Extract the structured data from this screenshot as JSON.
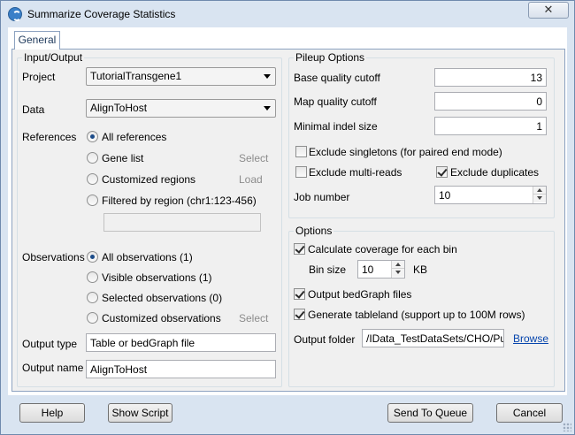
{
  "window": {
    "title": "Summarize Coverage Statistics",
    "close_glyph": "✕"
  },
  "tabs": [
    {
      "label": "General"
    }
  ],
  "input_output": {
    "group_title": "Input/Output",
    "project": {
      "label": "Project",
      "value": "TutorialTransgene1"
    },
    "data": {
      "label": "Data",
      "value": "AlignToHost"
    },
    "references": {
      "label": "References",
      "options": [
        {
          "label": "All references",
          "checked": true,
          "action": ""
        },
        {
          "label": "Gene list",
          "checked": false,
          "action": "Select"
        },
        {
          "label": "Customized regions",
          "checked": false,
          "action": "Load"
        },
        {
          "label": "Filtered by region (chr1:123-456)",
          "checked": false,
          "action": ""
        }
      ],
      "region_value": ""
    },
    "observations": {
      "label": "Observations",
      "options": [
        {
          "label": "All observations (1)",
          "checked": true
        },
        {
          "label": "Visible observations (1)",
          "checked": false
        },
        {
          "label": "Selected observations (0)",
          "checked": false
        },
        {
          "label": "Customized observations",
          "checked": false,
          "action": "Select"
        }
      ]
    },
    "output_type": {
      "label": "Output type",
      "value": "Table or bedGraph file"
    },
    "output_name": {
      "label": "Output name",
      "value": "AlignToHost"
    }
  },
  "pileup": {
    "group_title": "Pileup Options",
    "base_quality": {
      "label": "Base quality cutoff",
      "value": "13"
    },
    "map_quality": {
      "label": "Map quality cutoff",
      "value": "0"
    },
    "min_indel": {
      "label": "Minimal indel size",
      "value": "1"
    },
    "exclude_singletons": {
      "label": "Exclude singletons (for paired end mode)",
      "checked": false
    },
    "exclude_multi": {
      "label": "Exclude multi-reads",
      "checked": false
    },
    "exclude_duplicates": {
      "label": "Exclude duplicates",
      "checked": true
    },
    "job_number": {
      "label": "Job number",
      "value": "10"
    }
  },
  "options": {
    "group_title": "Options",
    "calc_coverage": {
      "label": "Calculate coverage for each bin",
      "checked": true
    },
    "bin_size": {
      "label": "Bin size",
      "value": "10",
      "unit": "KB"
    },
    "output_bedgraph": {
      "label": "Output bedGraph files",
      "checked": true
    },
    "tableland": {
      "label": "Generate tableland (support up to 100M rows)",
      "checked": true
    },
    "output_folder": {
      "label": "Output folder",
      "value": "/IData_TestDataSets/CHO/Pub",
      "browse": "Browse"
    }
  },
  "buttons": {
    "help": "Help",
    "show_script": "Show Script",
    "send_to_queue": "Send To Queue",
    "cancel": "Cancel"
  }
}
